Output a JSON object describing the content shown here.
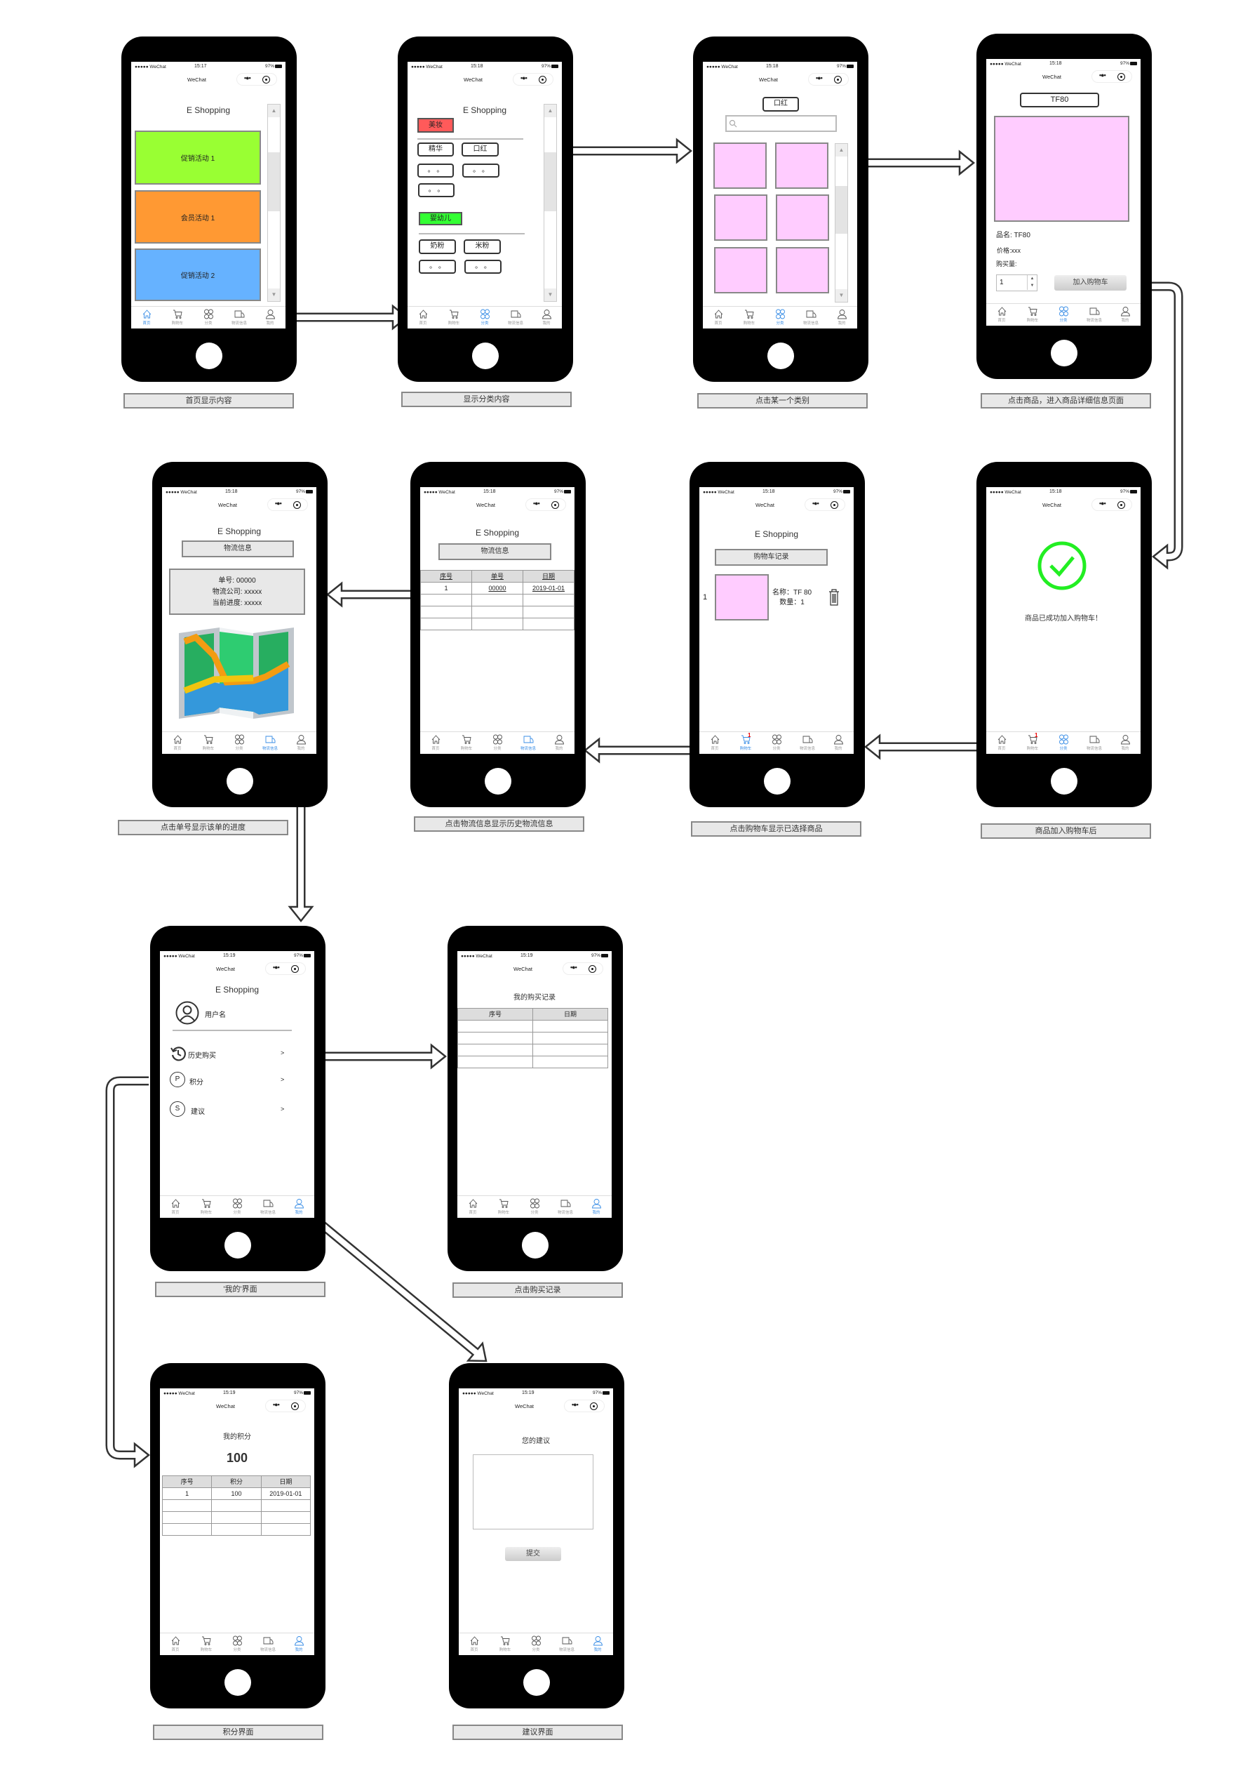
{
  "status": {
    "carrier": "●●●●● WeChat",
    "battery": "97%"
  },
  "nav_title": "WeChat",
  "tabs": [
    "首页",
    "购物车",
    "分类",
    "物流信息",
    "我的"
  ],
  "colors": {
    "accent": "#3a8ee6",
    "pink": "#ffccff",
    "green_banner": "#99ff33",
    "orange_banner": "#ff9933",
    "blue_banner": "#66b2ff",
    "red_tag": "#ff5a5a",
    "green_tag": "#33ff33",
    "check": "#22ee22"
  },
  "phones": [
    {
      "time": "15:17",
      "active_tab": 0,
      "caption": "首页显示内容",
      "title": "E Shopping",
      "banners": [
        "促销活动 1",
        "会员活动 1",
        "促销活动 2"
      ]
    },
    {
      "time": "15:18",
      "active_tab": 2,
      "caption": "显示分类内容",
      "title": "E Shopping",
      "categories": [
        {
          "name": "美妆",
          "items": [
            "精华",
            "口红",
            "。 。",
            "。 。",
            "。 。"
          ]
        },
        {
          "name": "婴幼儿",
          "items": [
            "奶粉",
            "米粉",
            "。 。",
            "。 。"
          ]
        }
      ]
    },
    {
      "time": "15:18",
      "active_tab": 2,
      "caption": "点击某一个类别",
      "category_button": "口红"
    },
    {
      "time": "15:18",
      "active_tab": 2,
      "caption": "点击商品，进入商品详细信息页面",
      "product_button": "TF80",
      "name_line": "品名: TF80",
      "price_line": "价格:xxx",
      "qty_label": "购买量:",
      "qty": "1",
      "add_button": "加入购物车"
    },
    {
      "time": "15:18",
      "active_tab": 3,
      "caption": "点击单号显示该单的进度",
      "title": "E Shopping",
      "button": "物流信息",
      "info": [
        "单号: 00000",
        "物流公司: xxxxx",
        "当前进度: xxxxx"
      ]
    },
    {
      "time": "15:18",
      "active_tab": 3,
      "caption": "点击物流信息显示历史物流信息",
      "title": "E Shopping",
      "button": "物流信息",
      "headers": [
        "序号",
        "单号",
        "日期"
      ],
      "rows": [
        [
          "1",
          "00000",
          "2019-01-01"
        ]
      ]
    },
    {
      "time": "15:18",
      "active_tab": 1,
      "cart_badge": "1",
      "caption": "点击购物车显示已选择商品",
      "title": "E Shopping",
      "button": "购物车记录",
      "item": {
        "index": "1",
        "name": "名称：TF 80",
        "qty": "数量：1"
      }
    },
    {
      "time": "15:18",
      "active_tab": 2,
      "cart_badge": "1",
      "caption": "商品加入购物车后",
      "message": "商品已成功加入购物车！"
    },
    {
      "time": "15:19",
      "active_tab": 4,
      "caption": "'我的'界面",
      "title": "E Shopping",
      "username": "用户名",
      "menu": [
        {
          "icon": "history-icon",
          "glyph": "",
          "label": "历史购买"
        },
        {
          "icon": "points-icon",
          "glyph": "P",
          "label": "积分"
        },
        {
          "icon": "suggestion-icon",
          "glyph": "S",
          "label": "建议"
        }
      ],
      "chevron": ">"
    },
    {
      "time": "15:19",
      "active_tab": 4,
      "caption": "点击购买记录",
      "heading": "我的购买记录",
      "headers": [
        "序号",
        "日期"
      ]
    },
    {
      "time": "15:19",
      "active_tab": 4,
      "caption": "积分界面",
      "heading": "我的积分",
      "points": "100",
      "headers": [
        "序号",
        "积分",
        "日期"
      ],
      "rows": [
        [
          "1",
          "100",
          "2019-01-01"
        ]
      ]
    },
    {
      "time": "15:19",
      "active_tab": 4,
      "caption": "建议界面",
      "heading": "您的建议",
      "submit": "提交"
    }
  ]
}
